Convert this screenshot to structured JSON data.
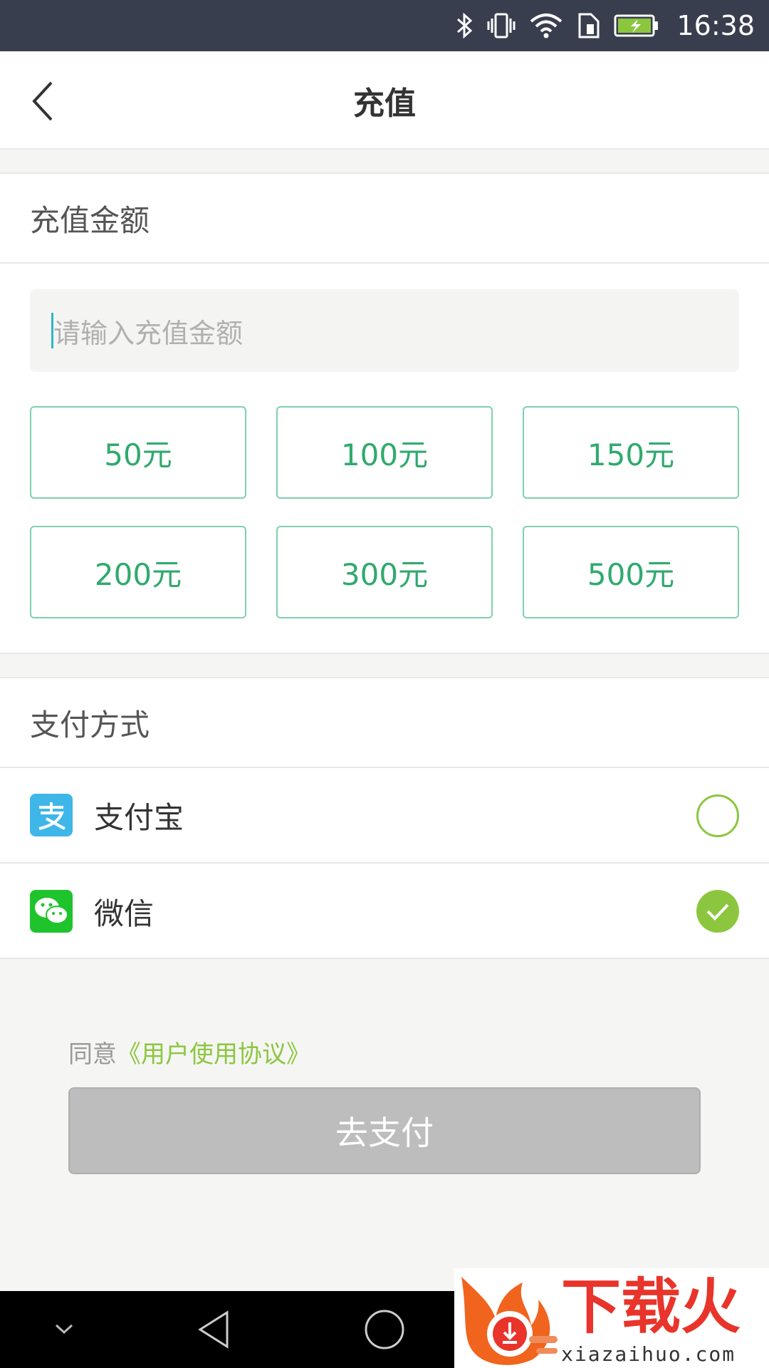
{
  "status_bar": {
    "time": "16:38"
  },
  "header": {
    "title": "充值"
  },
  "amount_section": {
    "title": "充值金额",
    "input_placeholder": "请输入充值金额",
    "input_value": "",
    "options": [
      "50元",
      "100元",
      "150元",
      "200元",
      "300元",
      "500元"
    ]
  },
  "payment_section": {
    "title": "支付方式",
    "methods": [
      {
        "label": "支付宝",
        "selected": false
      },
      {
        "label": "微信",
        "selected": true
      }
    ]
  },
  "agreement": {
    "prefix": "同意",
    "link": "《用户使用协议》"
  },
  "pay_button": {
    "label": "去支付"
  },
  "watermark": {
    "brand": "下载火",
    "domain": "xiazaihuo.com"
  },
  "colors": {
    "status_bar": "#383e4d",
    "accent_green": "#8cc63f",
    "amount_text": "#2faa6d",
    "button_disabled": "#bdbdbd",
    "alipay_blue": "#3fb6e8",
    "wechat_green": "#1fc42c"
  }
}
